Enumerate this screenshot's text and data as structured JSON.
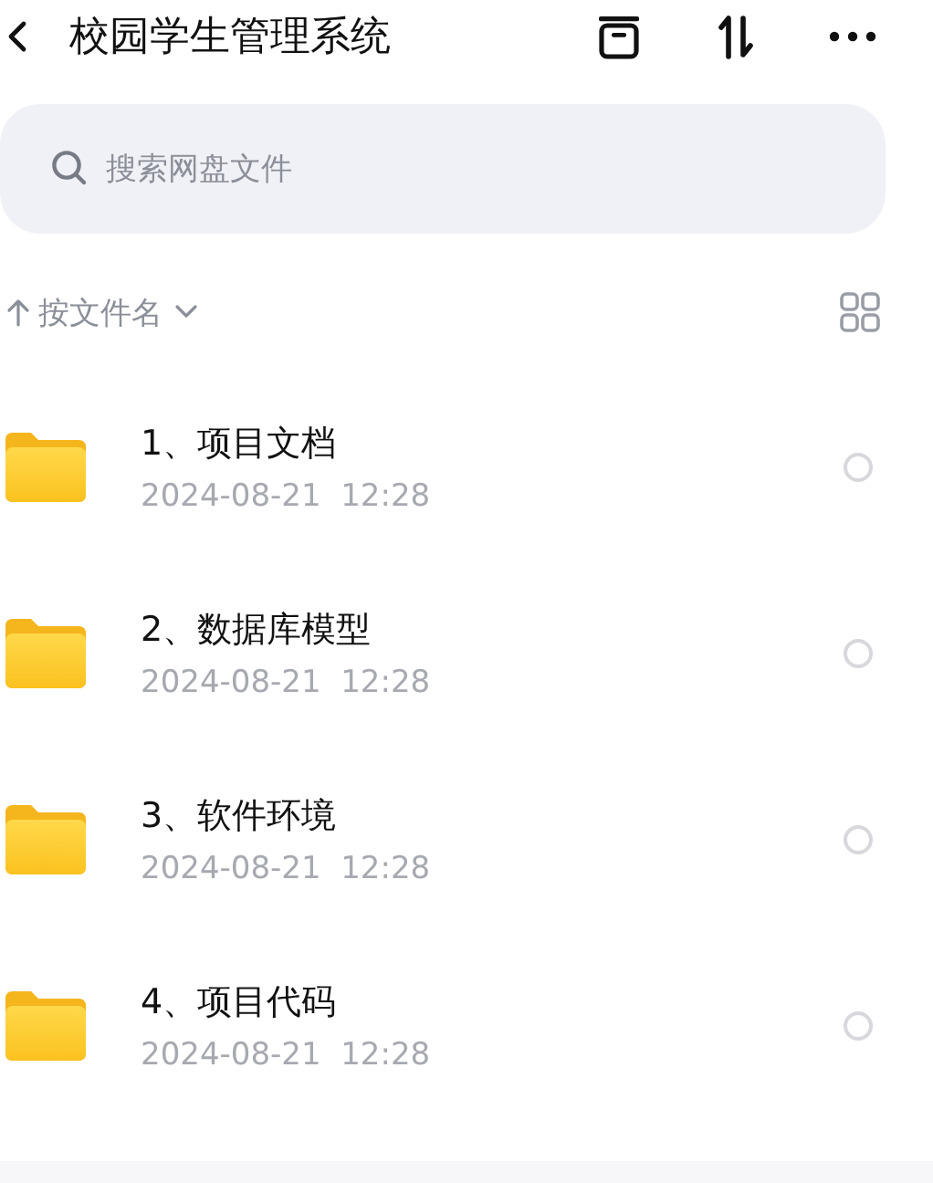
{
  "header": {
    "title": "校园学生管理系统"
  },
  "search": {
    "placeholder": "搜索网盘文件"
  },
  "sort": {
    "label": "按文件名"
  },
  "files": [
    {
      "name": "1、项目文档",
      "date": "2024-08-21  12:28",
      "selected": false
    },
    {
      "name": "2、数据库模型",
      "date": "2024-08-21  12:28",
      "selected": false
    },
    {
      "name": "3、软件环境",
      "date": "2024-08-21  12:28",
      "selected": false
    },
    {
      "name": "4、项目代码",
      "date": "2024-08-21  12:28",
      "selected": false
    }
  ]
}
